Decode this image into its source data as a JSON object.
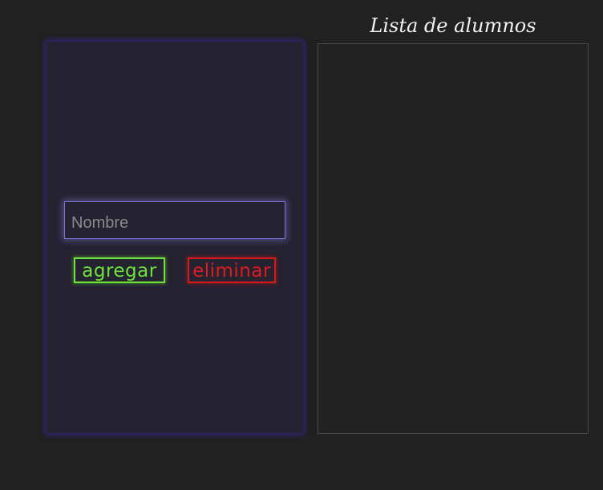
{
  "form": {
    "name_input": {
      "value": "",
      "placeholder": "Nombre"
    },
    "add_label": "agregar",
    "delete_label": "eliminar"
  },
  "list": {
    "title": "Lista de alumnos",
    "items": []
  },
  "colors": {
    "background": "#212121",
    "panel": "#252231",
    "panel_glow": "#32288c",
    "input_border": "#7b76d6",
    "add_accent": "#6ee33a",
    "delete_accent": "#d61a1a"
  }
}
